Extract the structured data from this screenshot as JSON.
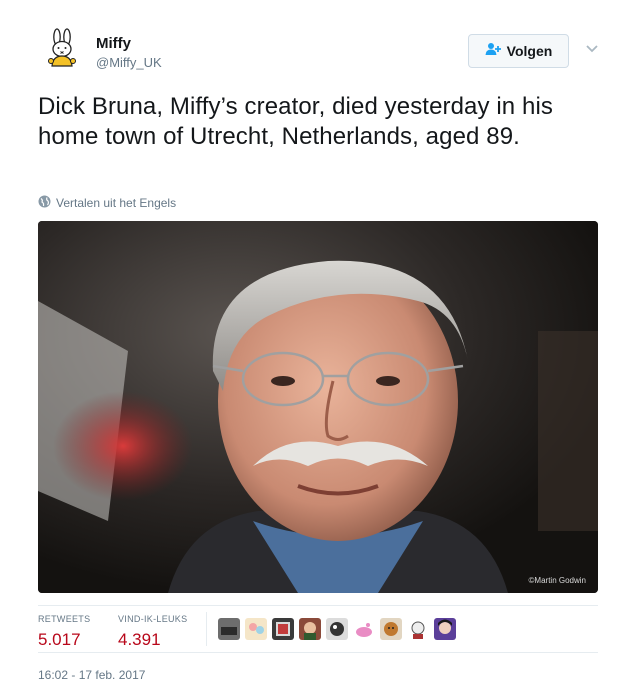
{
  "user": {
    "display_name": "Miffy",
    "handle": "@Miffy_UK",
    "avatar_icon": "miffy-avatar-icon"
  },
  "follow_button": {
    "label": "Volgen",
    "icon": "add-user-icon"
  },
  "menu": {
    "icon": "chevron-down-icon"
  },
  "tweet": {
    "text": "Dick Bruna, Miffy’s creator, died yesterday in his home town of Utrecht, Netherlands, aged 89."
  },
  "translate": {
    "label": "Vertalen uit het Engels",
    "icon": "globe-icon"
  },
  "photo": {
    "credit": "©Martin Godwin"
  },
  "stats": {
    "retweets_label": "RETWEETS",
    "retweets_value": "5.017",
    "likes_label": "VIND-IK-LEUKS",
    "likes_value": "4.391"
  },
  "timestamp": "16:02 - 17 feb. 2017",
  "colors": {
    "text": "#14171a",
    "secondary": "#657786",
    "stat_value": "#b8071a",
    "border": "#e6ecf0",
    "follow_icon": "#1da1f2"
  }
}
